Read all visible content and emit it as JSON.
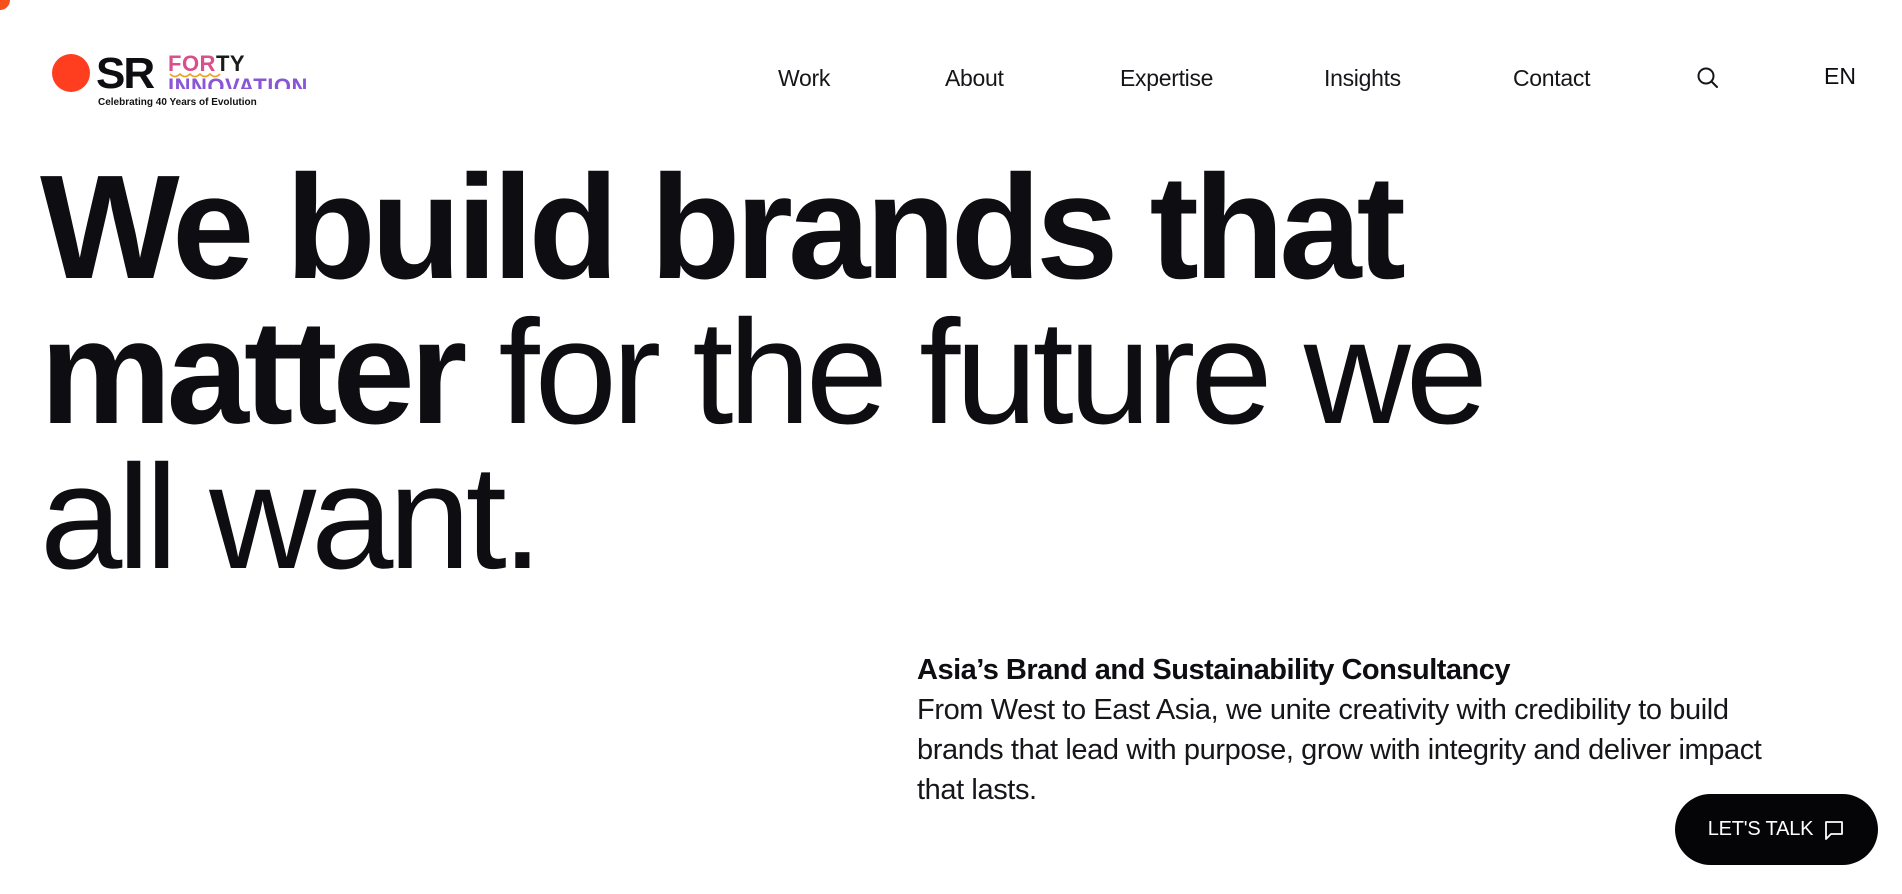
{
  "logo": {
    "mark": "SR",
    "forty_a": "FOR",
    "forty_b": "TY",
    "innovation": "INNOVATION",
    "tagline": "Celebrating 40 Years of Evolution"
  },
  "nav": {
    "items": [
      {
        "label": "Work"
      },
      {
        "label": "About"
      },
      {
        "label": "Expertise"
      },
      {
        "label": "Insights"
      },
      {
        "label": "Contact"
      }
    ],
    "search_icon": "search-icon",
    "language": "EN"
  },
  "hero": {
    "line1_bold": "We build brands that",
    "line2_bold": "matter",
    "line2_light": " for the future we",
    "line3_light": "all want."
  },
  "intro": {
    "title": "Asia’s Brand and Sustainability Consultancy",
    "body": "From West to East Asia, we unite creativity with credibility to build brands that lead with purpose, grow with integrity and deliver impact that lasts."
  },
  "cta": {
    "label": "LET'S TALK",
    "icon": "chat-icon"
  },
  "colors": {
    "brand_orange": "#ff3d1f",
    "forty_pink": "#d94f8c",
    "innovation_purple": "#8a56d6",
    "text": "#0e0e12",
    "cta_bg": "#050507"
  }
}
